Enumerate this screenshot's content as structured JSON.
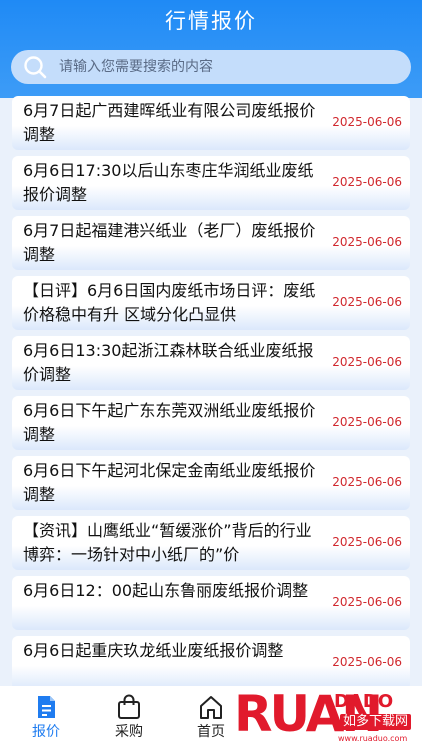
{
  "header": {
    "title": "行情报价"
  },
  "search": {
    "placeholder": "请输入您需要搜索的内容"
  },
  "news": [
    {
      "title": "6月7日起广西建晖纸业有限公司废纸报价调整",
      "date": "2025-06-06"
    },
    {
      "title": "6月6日17:30以后山东枣庄华润纸业废纸报价调整",
      "date": "2025-06-06"
    },
    {
      "title": "6月7日起福建港兴纸业（老厂）废纸报价调整",
      "date": "2025-06-06"
    },
    {
      "title": "【日评】6月6日国内废纸市场日评：废纸价格稳中有升 区域分化凸显供",
      "date": "2025-06-06"
    },
    {
      "title": "6月6日13:30起浙江森林联合纸业废纸报价调整",
      "date": "2025-06-06"
    },
    {
      "title": "6月6日下午起广东东莞双洲纸业废纸报价调整",
      "date": "2025-06-06"
    },
    {
      "title": "6月6日下午起河北保定金南纸业废纸报价调整",
      "date": "2025-06-06"
    },
    {
      "title": "【资讯】山鹰纸业“暂缓涨价”背后的行业博弈：一场针对中小纸厂的”价",
      "date": "2025-06-06"
    },
    {
      "title": "6月6日12：00起山东鲁丽废纸报价调整",
      "date": "2025-06-06"
    },
    {
      "title": "6月6日起重庆玖龙纸业废纸报价调整",
      "date": "2025-06-06"
    }
  ],
  "tabbar": {
    "tabs": [
      {
        "label": "报价",
        "icon": "document-icon",
        "active": true
      },
      {
        "label": "采购",
        "icon": "bag-icon",
        "active": false
      },
      {
        "label": "首页",
        "icon": "home-icon",
        "active": false
      }
    ]
  },
  "watermark": {
    "brand": "RUAN",
    "brand_small": "DADO",
    "cn": "如多下载网",
    "url": "www.ruaduo.com"
  },
  "colors": {
    "accent": "#1f8af5",
    "date": "#d0282e",
    "active_tab": "#1f7cf0",
    "watermark": "#e11a2c"
  }
}
